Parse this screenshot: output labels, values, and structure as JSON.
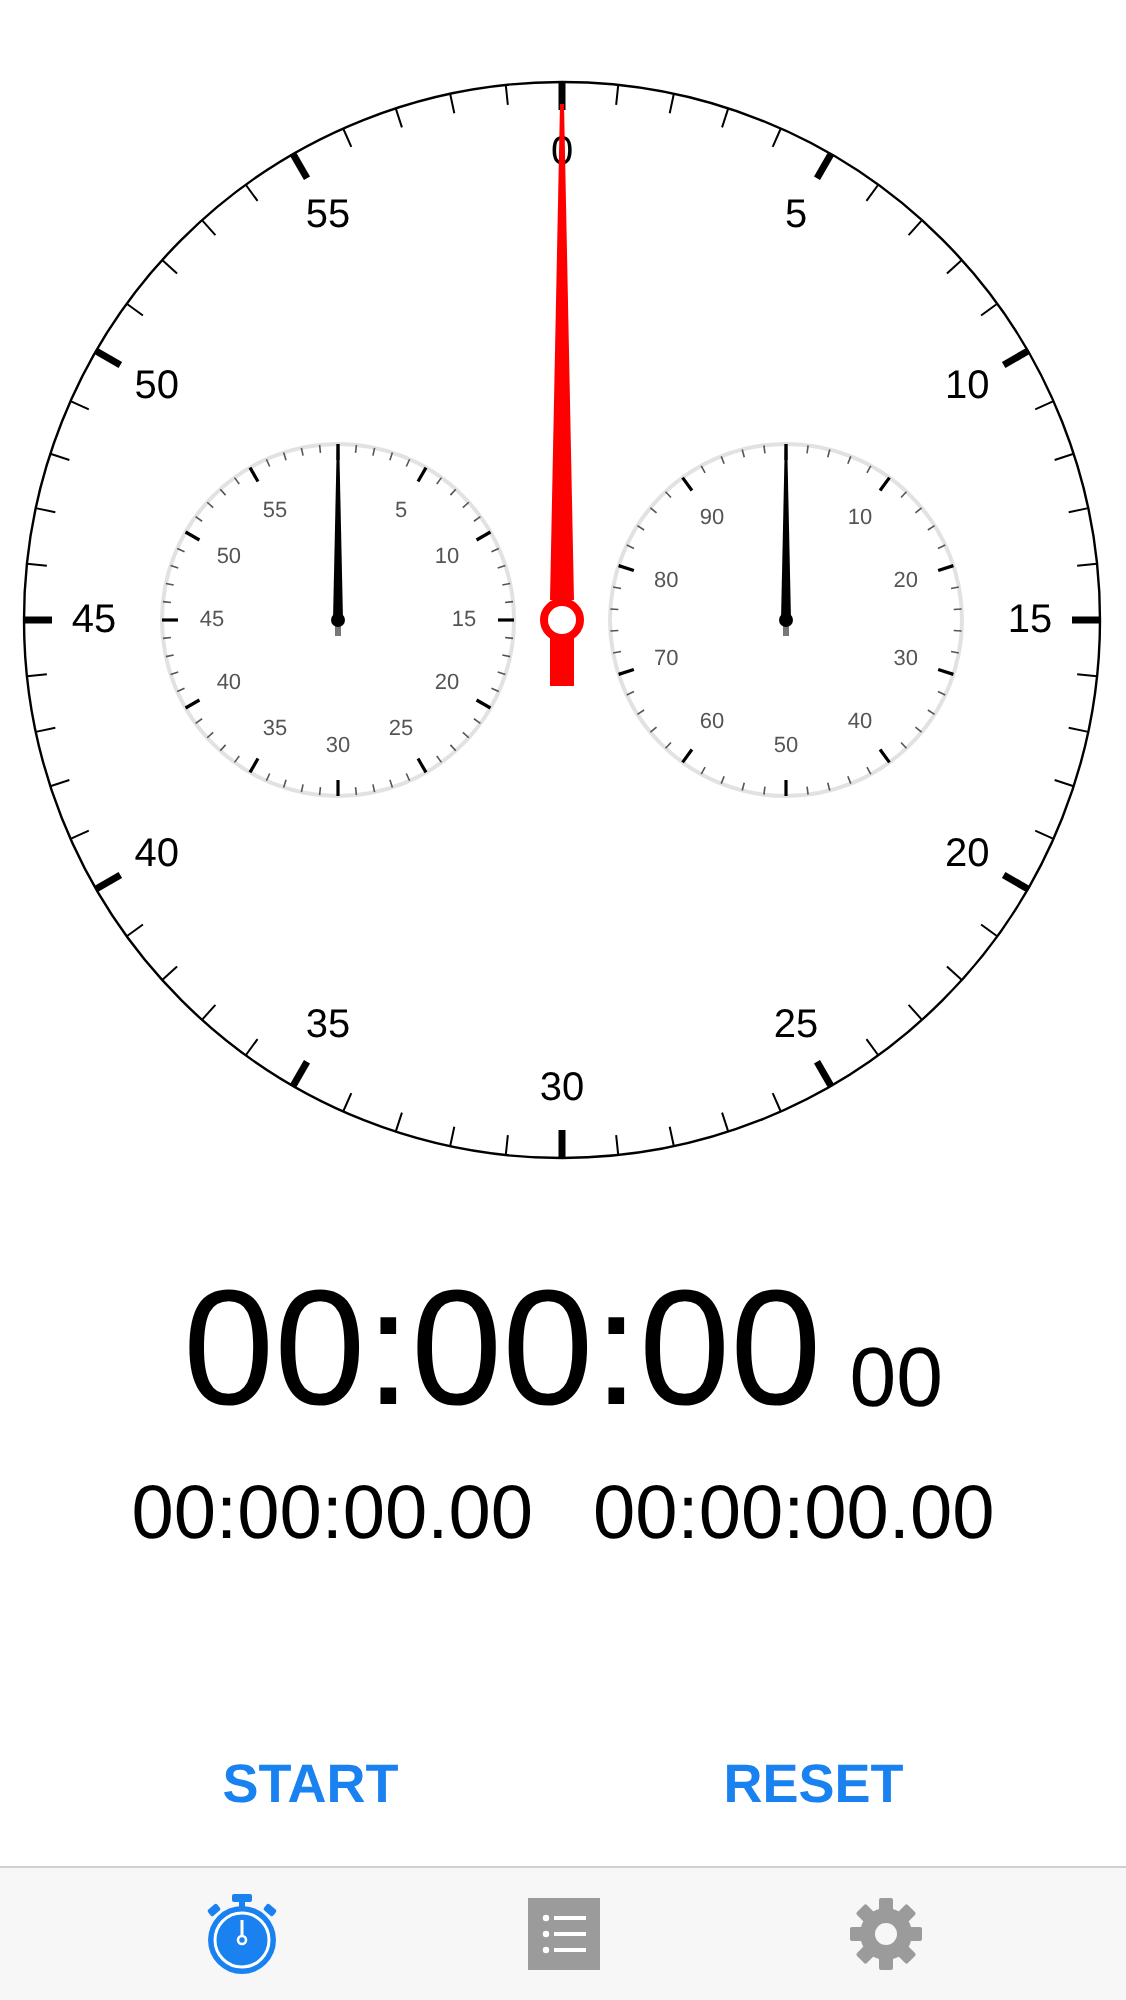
{
  "main_dial": {
    "labels": [
      "0",
      "5",
      "10",
      "15",
      "20",
      "25",
      "30",
      "35",
      "40",
      "45",
      "50",
      "55"
    ]
  },
  "left_dial": {
    "labels": [
      "5",
      "10",
      "15",
      "20",
      "25",
      "30",
      "35",
      "40",
      "45",
      "50",
      "55"
    ]
  },
  "right_dial": {
    "labels": [
      "10",
      "20",
      "30",
      "40",
      "50",
      "60",
      "70",
      "80",
      "90"
    ]
  },
  "time": {
    "main": "00:00:00",
    "fraction": "00"
  },
  "splits": [
    "00:00:00.00",
    "00:00:00.00"
  ],
  "buttons": [
    "START",
    "RESET"
  ],
  "tabs": [
    {
      "kind": "stopwatch",
      "selected": true
    },
    {
      "kind": "list",
      "selected": false
    },
    {
      "kind": "settings",
      "selected": false
    }
  ]
}
